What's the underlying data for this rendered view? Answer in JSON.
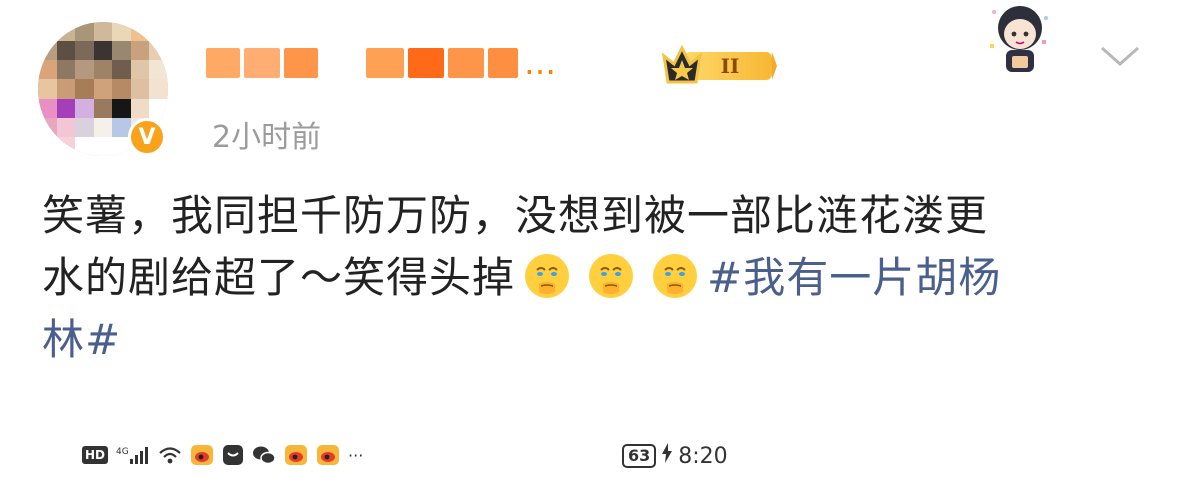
{
  "post": {
    "author_name_visible": "…",
    "vip_level": "II",
    "timestamp": "2小时前",
    "text_line1": "笑薯，我同担千防万防，没想到被一部比涟花溇更",
    "text_line2": "水的剧给超了～笑得头掉",
    "hashtag_part1": "#我有一片胡杨",
    "hashtag_part2": "林#",
    "emoji_count": 3,
    "verified_mark": "V"
  },
  "status_bar": {
    "hd": "HD",
    "network": "4G",
    "battery": "63",
    "time": "8:20",
    "more": "···"
  },
  "colors": {
    "accent_orange": "#ff8200",
    "hashtag_blue": "#4a5f8c",
    "timestamp_gray": "#9b9b9b",
    "text_dark": "#222222"
  },
  "icons": {
    "verified": "verified-badge-icon",
    "vip": "crown-vip-icon",
    "menu": "chevron-down-icon",
    "emoji": "crying-emoji-icon"
  }
}
